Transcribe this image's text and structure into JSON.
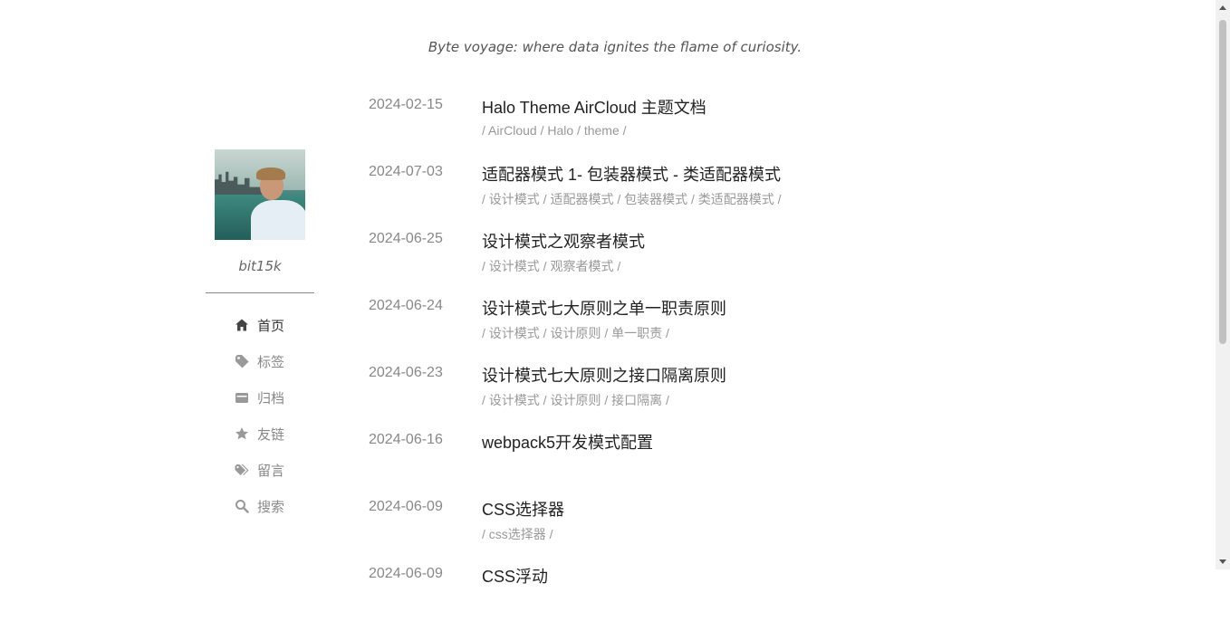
{
  "header": {
    "tagline": "Byte voyage: where data ignites the flame of curiosity."
  },
  "sidebar": {
    "username": "bit15k",
    "nav": [
      {
        "label": "首页",
        "icon": "home-icon",
        "active": true
      },
      {
        "label": "标签",
        "icon": "tag-icon",
        "active": false
      },
      {
        "label": "归档",
        "icon": "folder-icon",
        "active": false
      },
      {
        "label": "友链",
        "icon": "star-icon",
        "active": false
      },
      {
        "label": "留言",
        "icon": "tags-icon",
        "active": false
      },
      {
        "label": "搜索",
        "icon": "search-icon",
        "active": false
      }
    ]
  },
  "posts": [
    {
      "date": "2024-02-15",
      "title": "Halo Theme AirCloud 主题文档",
      "tags": "/ AirCloud / Halo / theme /"
    },
    {
      "date": "2024-07-03",
      "title": "适配器模式 1- 包装器模式 - 类适配器模式",
      "tags": "/ 设计模式 / 适配器模式 / 包装器模式 / 类适配器模式 /"
    },
    {
      "date": "2024-06-25",
      "title": "设计模式之观察者模式",
      "tags": "/ 设计模式 / 观察者模式 /"
    },
    {
      "date": "2024-06-24",
      "title": "设计模式七大原则之单一职责原则",
      "tags": "/ 设计模式 / 设计原则 / 单一职责 /"
    },
    {
      "date": "2024-06-23",
      "title": "设计模式七大原则之接口隔离原则",
      "tags": "/ 设计模式 / 设计原则 / 接口隔离 /"
    },
    {
      "date": "2024-06-16",
      "title": "webpack5开发模式配置",
      "tags": ""
    },
    {
      "date": "2024-06-09",
      "title": "CSS选择器",
      "tags": "/ css选择器 /"
    },
    {
      "date": "2024-06-09",
      "title": "CSS浮动",
      "tags": ""
    }
  ],
  "colors": {
    "text": "#222222",
    "muted": "#888888",
    "tags": "#999999"
  }
}
